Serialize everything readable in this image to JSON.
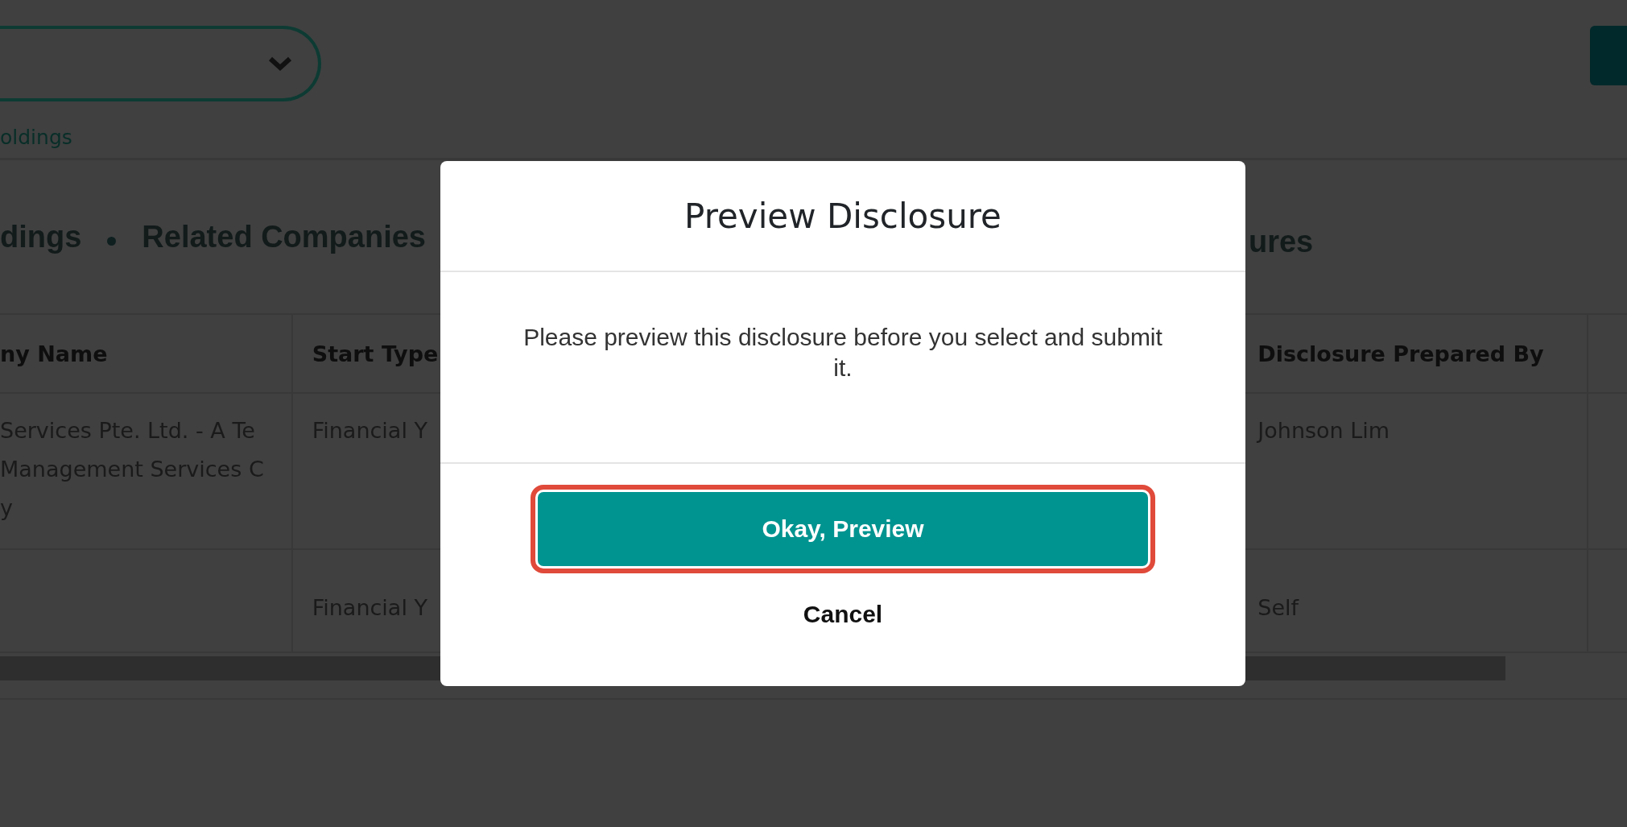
{
  "filter": {
    "link": "oldings"
  },
  "tabs": [
    {
      "label": "dings"
    },
    {
      "label": "Related Companies"
    },
    {
      "label": "ures"
    }
  ],
  "table": {
    "columns": [
      "ny Name",
      "Start Type",
      "Disclosure Prepared By"
    ],
    "rows": [
      [
        "Services Pte. Ltd. - A Te\nManagement Services C\ny",
        "Financial Y",
        "Johnson Lim"
      ],
      [
        "",
        "Financial Y",
        "Self"
      ]
    ]
  },
  "dialog": {
    "title": "Preview Disclosure",
    "message": "Please preview this disclosure before you select and submit it.",
    "buttons": [
      {
        "kind": "primary",
        "label": "Okay, Preview",
        "highlighted": true
      },
      {
        "kind": "link",
        "label": "Cancel",
        "highlighted": false
      }
    ]
  }
}
